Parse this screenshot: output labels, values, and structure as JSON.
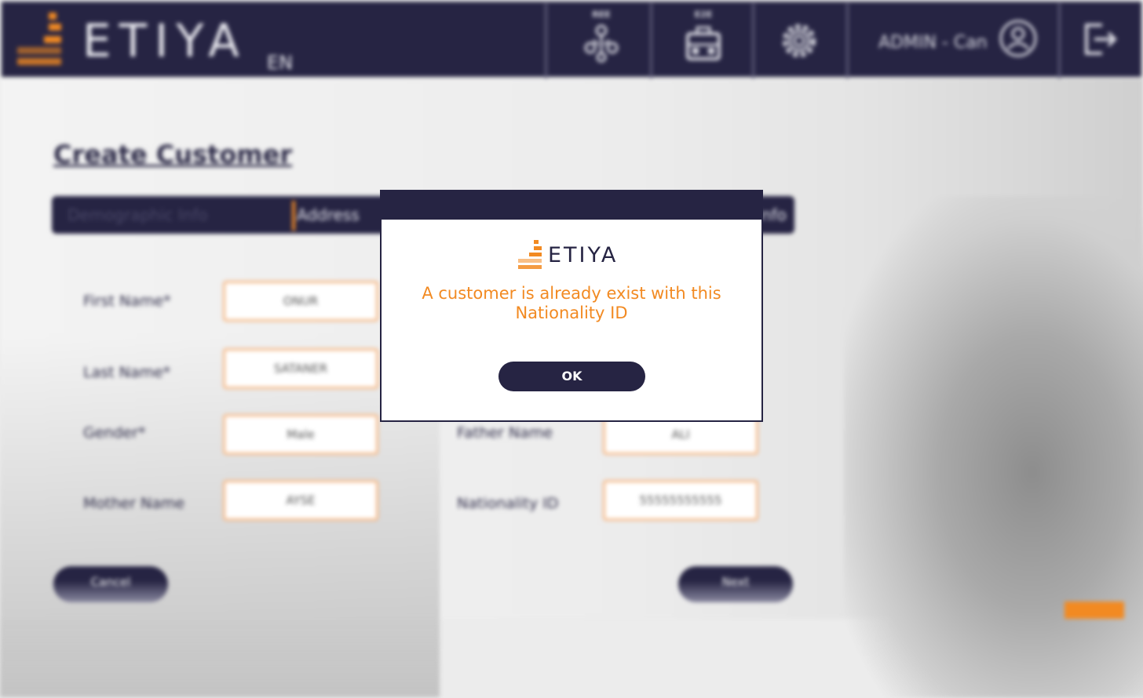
{
  "header": {
    "brand": "ETIYA",
    "language": "EN",
    "nav_icon_1_label": "REE",
    "nav_icon_2_label": "E2E",
    "user": "ADMIN - Can"
  },
  "page": {
    "title": "Create Customer",
    "tabs": [
      {
        "label": "Demographic Info",
        "active": true
      },
      {
        "label": "Address",
        "active": false
      },
      {
        "label": "Info",
        "active": false
      }
    ],
    "fields": {
      "first_name": {
        "label": "First Name*",
        "value": "ONUR"
      },
      "last_name": {
        "label": "Last Name*",
        "value": "SATANER"
      },
      "gender": {
        "label": "Gender*",
        "value": "Male"
      },
      "mother_name": {
        "label": "Mother Name",
        "value": "AYSE"
      },
      "father_name": {
        "label": "Father Name",
        "value": "ALI"
      },
      "nationality_id": {
        "label": "Nationality ID",
        "value": "55555555555"
      }
    },
    "cancel_label": "Cancel",
    "next_label": "Next"
  },
  "modal": {
    "brand": "ETIYA",
    "message": "A customer is already exist with this Nationality ID",
    "ok_label": "OK"
  },
  "colors": {
    "navy": "#262443",
    "orange": "#f28a22",
    "input_border": "#f6b987"
  }
}
